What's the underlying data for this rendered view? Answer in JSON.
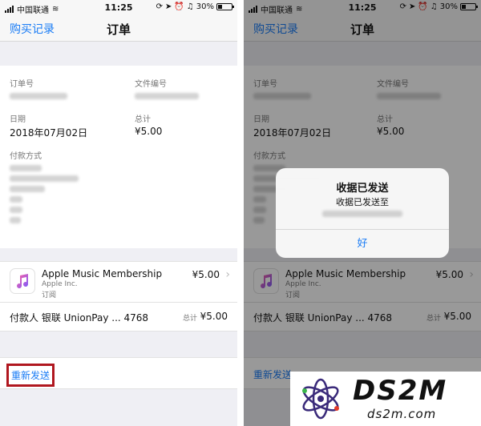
{
  "status_bar": {
    "carrier": "中国联通",
    "time": "11:25",
    "battery": "30%"
  },
  "nav": {
    "back_label": "购买记录",
    "title": "订单"
  },
  "order": {
    "order_no_label": "订单号",
    "doc_no_label": "文件编号",
    "date_label": "日期",
    "date_value": "2018年07月02日",
    "total_label": "总计",
    "total_value": "¥5.00",
    "payment_label": "付款方式"
  },
  "item": {
    "name": "Apple Music Membership",
    "vendor": "Apple Inc.",
    "type": "订阅",
    "price": "¥5.00"
  },
  "payment": {
    "payer_text": "付款人 银联 UnionPay ... 4768",
    "total_label": "总计",
    "total_value": "¥5.00"
  },
  "resend_label": "重新发送",
  "alert": {
    "title": "收据已发送",
    "message": "收据已发送至",
    "ok_label": "好"
  },
  "watermark": {
    "main": "DS2M",
    "sub": "ds2m.com"
  },
  "colors": {
    "link_blue": "#1a7cf5",
    "highlight_red": "#b0171f"
  }
}
